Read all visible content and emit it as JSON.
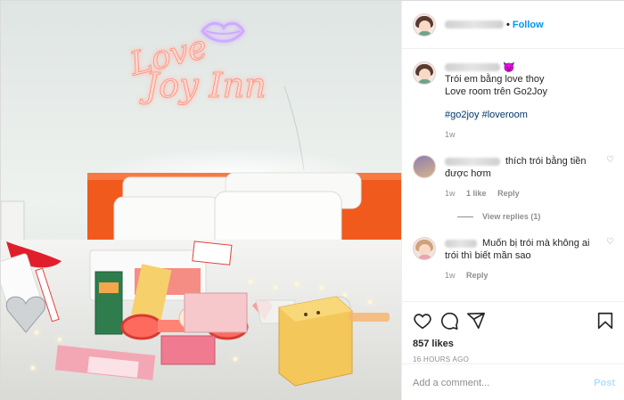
{
  "header": {
    "separator": "•",
    "follow_label": "Follow"
  },
  "caption": {
    "emoji": "😈",
    "line1": "Trói em bằng love thoy",
    "line2": "Love room trên Go2Joy",
    "hashtags": "#go2joy #loveroom",
    "age": "1w"
  },
  "comments": [
    {
      "text": "thích trói bằng tiền được hơm",
      "age": "1w",
      "likes": "1 like",
      "reply_label": "Reply",
      "view_replies": "View replies (1)"
    },
    {
      "text": "Muốn bị trói mà không ai trói thì biết mần sao",
      "age": "1w",
      "reply_label": "Reply"
    }
  ],
  "post": {
    "likes": "857 likes",
    "timestamp": "16 HOURS AGO"
  },
  "add_comment": {
    "placeholder": "Add a comment...",
    "post_label": "Post"
  },
  "photo": {
    "neon_line1": "Love",
    "neon_line2": "Joy Inn",
    "colors": {
      "wall": "#e7ecea",
      "headboard": "#f05a1c",
      "neon": "#ffd3c7",
      "neon_glow": "#ff7e6e",
      "lips": "#c9a6ff"
    }
  },
  "icons": [
    "heart-icon",
    "comment-icon",
    "share-icon",
    "bookmark-icon"
  ]
}
